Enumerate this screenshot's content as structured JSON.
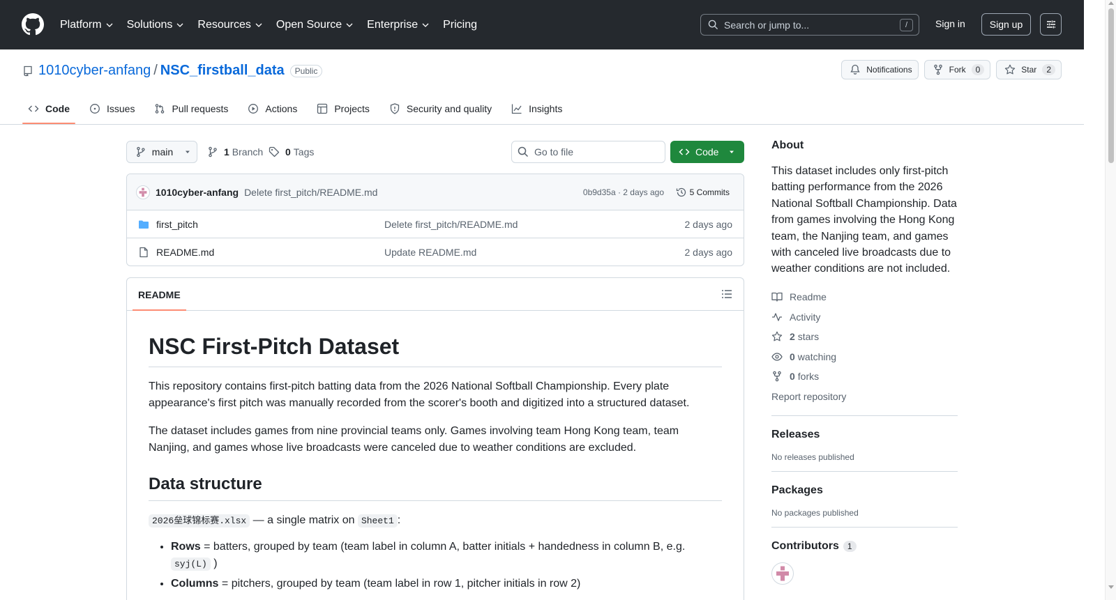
{
  "header": {
    "nav": [
      "Platform",
      "Solutions",
      "Resources",
      "Open Source",
      "Enterprise",
      "Pricing"
    ],
    "search_placeholder": "Search or jump to...",
    "search_shortcut": "/",
    "signin": "Sign in",
    "signup": "Sign up"
  },
  "repo": {
    "owner": "1010cyber-anfang",
    "separator": "/",
    "name": "NSC_firstball_data",
    "visibility": "Public",
    "notifications_label": "Notifications",
    "fork_label": "Fork",
    "fork_count": "0",
    "star_label": "Star",
    "star_count": "2"
  },
  "tabs": [
    {
      "label": "Code",
      "icon": "code-icon"
    },
    {
      "label": "Issues",
      "icon": "issue-icon"
    },
    {
      "label": "Pull requests",
      "icon": "pull-request-icon"
    },
    {
      "label": "Actions",
      "icon": "play-icon"
    },
    {
      "label": "Projects",
      "icon": "table-icon"
    },
    {
      "label": "Security and quality",
      "icon": "shield-icon"
    },
    {
      "label": "Insights",
      "icon": "graph-icon"
    }
  ],
  "toolbar": {
    "branch": "main",
    "branch_count": "1",
    "branch_label": "Branch",
    "tag_count": "0",
    "tag_label": "Tags",
    "goto_placeholder": "Go to file",
    "code_button": "Code"
  },
  "latest_commit": {
    "author": "1010cyber-anfang",
    "message": "Delete first_pitch/README.md",
    "meta": "0b9d35a · 2 days ago",
    "commits_label": "5 Commits"
  },
  "files": [
    {
      "name": "first_pitch",
      "type": "folder",
      "commit": "Delete first_pitch/README.md",
      "time": "2 days ago"
    },
    {
      "name": "README.md",
      "type": "file",
      "commit": "Update README.md",
      "time": "2 days ago"
    }
  ],
  "readme": {
    "tab": "README",
    "h1": "NSC First-Pitch Dataset",
    "p1": "This repository contains first-pitch batting data from the 2026 National Softball Championship. Every plate appearance's first pitch was manually recorded from the scorer's booth and digitized into a structured dataset.",
    "p2": "The dataset includes games from nine provincial teams only. Games involving team Hong Kong team, team Nanjing, and games whose live broadcasts were canceled due to weather conditions are excluded.",
    "h2": "Data structure",
    "file_code": "2026垒球锦标赛.xlsx",
    "matrix_text": " — a single matrix on ",
    "sheet_code": "Sheet1",
    "colon": ":",
    "rows_label": "Rows",
    "rows_text": " = batters, grouped by team (team label in column A, batter initials + handedness in column B, e.g. ",
    "rows_code": "syj(L)",
    "rows_end": " )",
    "cols_label": "Columns",
    "cols_text": " = pitchers, grouped by team (team label in row 1, pitcher initials in row 2)"
  },
  "about": {
    "title": "About",
    "description": "This dataset includes only first-pitch batting performance from the 2026 National Softball Championship. Data from games involving the Hong Kong team, the Nanjing team, and games with canceled live broadcasts due to weather conditions are not included.",
    "readme": "Readme",
    "activity": "Activity",
    "stars_count": "2",
    "stars_label": "stars",
    "watching_count": "0",
    "watching_label": "watching",
    "forks_count": "0",
    "forks_label": "forks",
    "report": "Report repository"
  },
  "releases": {
    "title": "Releases",
    "sub": "No releases published"
  },
  "packages": {
    "title": "Packages",
    "sub": "No packages published"
  },
  "contributors": {
    "title": "Contributors",
    "count": "1"
  },
  "colors": {
    "header_bg": "#25292e",
    "link": "#0969da",
    "accent_green": "#1f883d",
    "tab_underline": "#fd8c73"
  }
}
